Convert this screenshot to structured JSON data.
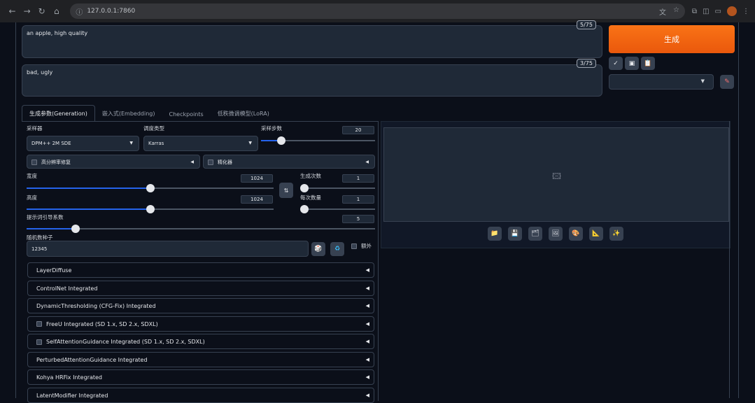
{
  "browser": {
    "url": "127.0.0.1:7860",
    "nav": [
      "←",
      "→",
      "↻",
      "⌂"
    ]
  },
  "prompt": {
    "positive": "an apple, high quality",
    "positive_count": "5/75",
    "negative": "bad, ugly",
    "negative_count": "3/75"
  },
  "actions": {
    "generate_label": "生成",
    "tools": [
      "✓",
      "▣",
      "📋"
    ],
    "edit_icon": "✎"
  },
  "tabs": [
    "生成参数(Generation)",
    "嵌入式(Embedding)",
    "Checkpoints",
    "低秩微调模型(LoRA)"
  ],
  "params": {
    "sampler_label": "采样器",
    "sampler_value": "DPM++ 2M SDE",
    "schedule_label": "调度类型",
    "schedule_value": "Karras",
    "steps_label": "采样步数",
    "steps_value": "20",
    "hires_label": "高分辨率修复",
    "refiner_label": "精化器",
    "width_label": "宽度",
    "width_value": "1024",
    "height_label": "高度",
    "height_value": "1024",
    "batch_count_label": "生成次数",
    "batch_count_value": "1",
    "batch_size_label": "每次数量",
    "batch_size_value": "1",
    "cfg_label": "提示词引导系数",
    "cfg_value": "5",
    "seed_label": "随机数种子",
    "seed_value": "12345",
    "extra_label": "额外",
    "swap_icon": "⇅",
    "dice_icon": "🎲",
    "recycle_icon": "♻"
  },
  "sliders": {
    "steps": 0.18,
    "width": 0.5,
    "height": 0.5,
    "batch_count": 0.0,
    "batch_size": 0.0,
    "cfg": 0.14
  },
  "accordions": [
    {
      "label": "LayerDiffuse",
      "checkbox": false
    },
    {
      "label": "ControlNet Integrated",
      "checkbox": false
    },
    {
      "label": "DynamicThresholding (CFG-Fix) Integrated",
      "checkbox": false
    },
    {
      "label": "FreeU Integrated (SD 1.x, SD 2.x, SDXL)",
      "checkbox": true
    },
    {
      "label": "SelfAttentionGuidance Integrated (SD 1.x, SD 2.x, SDXL)",
      "checkbox": true
    },
    {
      "label": "PerturbedAttentionGuidance Integrated",
      "checkbox": false
    },
    {
      "label": "Kohya HRFix Integrated",
      "checkbox": false
    },
    {
      "label": "LatentModifier Integrated",
      "checkbox": false
    }
  ],
  "output_buttons": [
    "📁",
    "💾",
    "🗂",
    "🖼",
    "🎨",
    "📐",
    "✨"
  ],
  "colors": {
    "accent": "#ea580c",
    "slider": "#2563eb",
    "bg": "#0b0f19"
  }
}
